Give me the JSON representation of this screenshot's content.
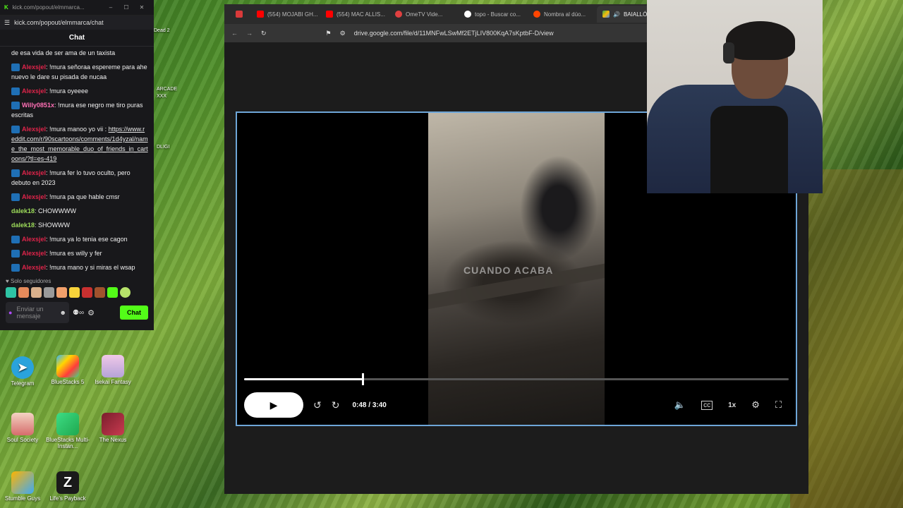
{
  "colors": {
    "kick_green": "#53fc18",
    "user_red": "#e0244a",
    "user_pink": "#ff6fb5",
    "user_green": "#9ddc5a",
    "player_border": "#6ea6d8"
  },
  "desktop": {
    "icons": [
      {
        "label": "Telegram",
        "icon": "telegram-icon"
      },
      {
        "label": "BlueStacks 5",
        "icon": "bluestacks-icon"
      },
      {
        "label": "Isekai Fantasy",
        "icon": "isekai-fantasy-icon"
      },
      {
        "label": "Soul Society",
        "icon": "soul-society-icon"
      },
      {
        "label": "BlueStacks Multi-Instan...",
        "icon": "bluestacks-multi-icon"
      },
      {
        "label": "The Nexus",
        "icon": "the-nexus-icon"
      },
      {
        "label": "Stumble Guys",
        "icon": "stumble-guys-icon"
      },
      {
        "label": "Life's Payback",
        "icon": "lifes-payback-icon"
      }
    ],
    "partial_labels": [
      "Dead 2",
      "ARCADE",
      "XXX",
      "DLIGI"
    ]
  },
  "chat": {
    "window_title": "kick.com/popout/elmmarca...",
    "url": "kick.com/popout/elmmarca/chat",
    "header": "Chat",
    "messages": [
      {
        "user": "",
        "text": "de esa vida de ser ama de un taxista",
        "color": ""
      },
      {
        "user": "Alexsjel",
        "text": ": !mura señoraa espereme para ahe nuevo le dare su pisada de nucaa",
        "color": "#e0244a"
      },
      {
        "user": "Alexsjel",
        "text": ": !mura oyeeee",
        "color": "#e0244a"
      },
      {
        "user": "Willy0851x",
        "text": ": !mura ese negro me tiro puras escritas",
        "color": "#ff6fb5"
      },
      {
        "user": "Alexsjel",
        "text": ": !mura manoo yo vii :",
        "link": "https://www.reddit.com/r/90scartoons/comments/1d4yzal/name_the_most_memorable_duo_of_friends_in_cartoons/?tl=es-419",
        "color": "#e0244a"
      },
      {
        "user": "Alexsjel",
        "text": ": !mura fer lo tuvo oculto, pero debuto en 2023",
        "color": "#e0244a"
      },
      {
        "user": "Alexsjel",
        "text": ": !mura pa que hable cmsr",
        "color": "#e0244a"
      },
      {
        "user": "dalek18",
        "text": ": CHOWWWW",
        "color": "#9ddc5a"
      },
      {
        "user": "dalek18",
        "text": ": SHOWWW",
        "color": "#9ddc5a"
      },
      {
        "user": "Alexsjel",
        "text": ": !mura ya lo tenia ese cagon",
        "color": "#e0244a"
      },
      {
        "user": "Alexsjel",
        "text": ": !mura es willy y fer",
        "color": "#e0244a"
      },
      {
        "user": "Alexsjel",
        "text": ": !mura mano y si miras el wsap",
        "color": "#e0244a"
      }
    ],
    "followers_only": "Solo seguidores",
    "input_placeholder": "Enviar un mensaje",
    "send_label": "Chat"
  },
  "browser": {
    "tabs": [
      {
        "title": "",
        "icon": "pinned-tab-icon"
      },
      {
        "title": "(554) MOJABI GH...",
        "icon": "youtube-icon"
      },
      {
        "title": "(554) MAC ALLIS...",
        "icon": "youtube-icon"
      },
      {
        "title": "OmeTV Vide...",
        "icon": "ometv-icon"
      },
      {
        "title": "topo - Buscar co...",
        "icon": "google-icon"
      },
      {
        "title": "Nombra al dúo...",
        "icon": "reddit-icon"
      },
      {
        "title": "BAIALLÓ...",
        "icon": "drive-icon",
        "active": true
      }
    ],
    "url": "drive.google.com/file/d/11MNFwLSwMf2ETjLIV800KqA7sKptbF-D/view"
  },
  "player": {
    "watermark": "CUANDO ACABA",
    "current_time": "0:48",
    "duration": "3:40",
    "progress": 0.218,
    "speed": "1x"
  }
}
